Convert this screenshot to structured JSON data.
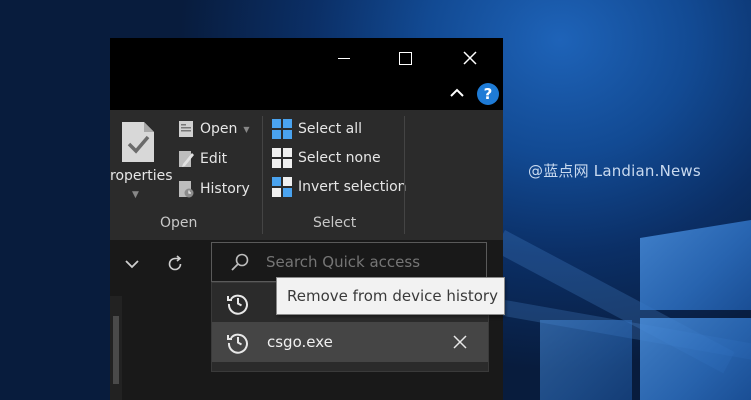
{
  "watermark": "@蓝点网 Landian.News",
  "ribbon": {
    "properties_label": "roperties",
    "open_label": "Open",
    "edit_label": "Edit",
    "history_label": "History",
    "select_all_label": "Select all",
    "select_none_label": "Select none",
    "invert_selection_label": "Invert selection",
    "group_open_label": "Open",
    "group_select_label": "Select"
  },
  "search": {
    "placeholder": "Search Quick access"
  },
  "history": {
    "items": [
      {
        "label": "csgo.exe"
      }
    ]
  },
  "tooltip": "Remove from device history",
  "colors": {
    "accent": "#2d7fd6",
    "window_bg": "#191919",
    "ribbon_bg": "#2b2b2b",
    "help_blue": "#1e7bd6"
  },
  "icons": [
    "minimize-icon",
    "maximize-icon",
    "close-icon",
    "chevron-up-icon",
    "help-icon",
    "properties-icon",
    "open-icon",
    "edit-icon",
    "history-icon",
    "select-all-icon",
    "select-none-icon",
    "invert-selection-icon",
    "chevron-down-icon",
    "refresh-icon",
    "search-icon",
    "history-clock-icon",
    "remove-icon"
  ]
}
